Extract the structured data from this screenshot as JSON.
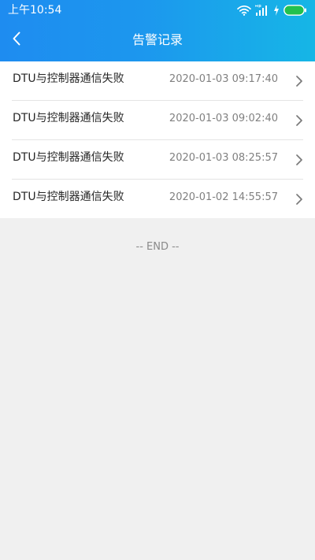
{
  "status_bar": {
    "time": "上午10:54",
    "icons": [
      "wifi-icon",
      "signal-icon",
      "charging-icon",
      "battery-icon"
    ],
    "battery_color": "#22c14e"
  },
  "nav": {
    "title": "告警记录",
    "back_icon": "chevron-left-icon"
  },
  "alarm_list": [
    {
      "title": "DTU与控制器通信失败",
      "time": "2020-01-03 09:17:40"
    },
    {
      "title": "DTU与控制器通信失败",
      "time": "2020-01-03 09:02:40"
    },
    {
      "title": "DTU与控制器通信失败",
      "time": "2020-01-03 08:25:57"
    },
    {
      "title": "DTU与控制器通信失败",
      "time": "2020-01-02 14:55:57"
    }
  ],
  "end_text": "-- END --",
  "colors": {
    "header_start": "#1e8cf0",
    "header_end": "#16b6e6",
    "page_background": "#f0f0f0"
  }
}
